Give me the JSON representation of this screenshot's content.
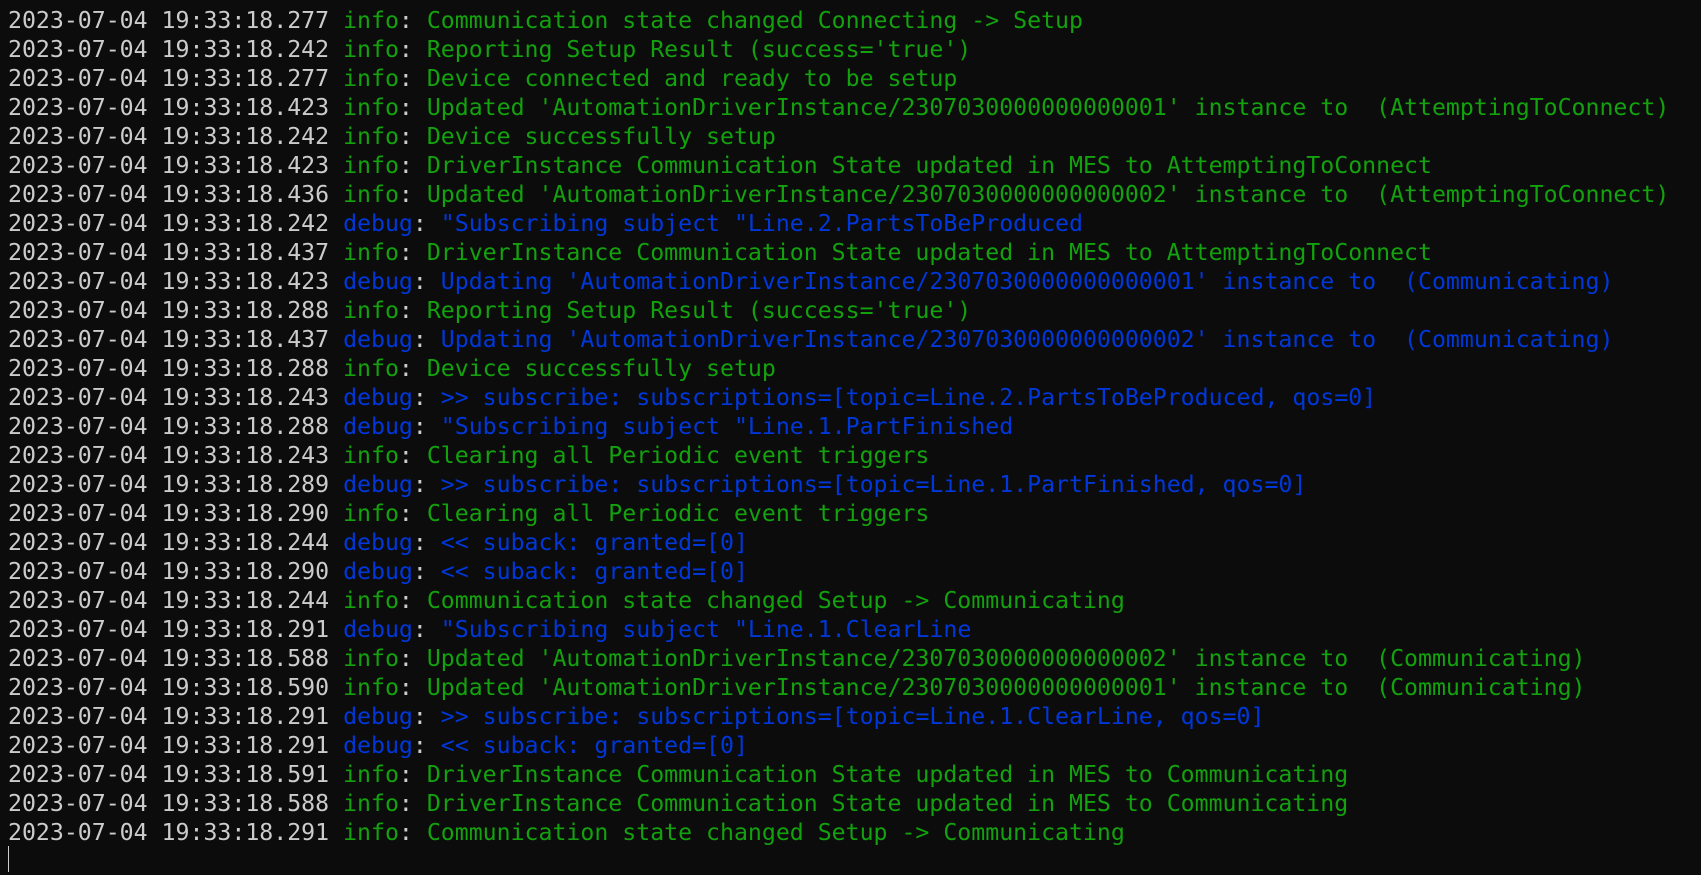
{
  "colors": {
    "background": "#0c0c0c",
    "timestamp": "#cccccc",
    "info": "#13a10e",
    "debug": "#0037da"
  },
  "log": [
    {
      "ts": "2023-07-04 19:33:18.277",
      "level": "info",
      "msg": "Communication state changed Connecting -> Setup"
    },
    {
      "ts": "2023-07-04 19:33:18.242",
      "level": "info",
      "msg": "Reporting Setup Result (success='true')"
    },
    {
      "ts": "2023-07-04 19:33:18.277",
      "level": "info",
      "msg": "Device connected and ready to be setup"
    },
    {
      "ts": "2023-07-04 19:33:18.423",
      "level": "info",
      "msg": "Updated 'AutomationDriverInstance/2307030000000000001' instance to  (AttemptingToConnect)"
    },
    {
      "ts": "2023-07-04 19:33:18.242",
      "level": "info",
      "msg": "Device successfully setup"
    },
    {
      "ts": "2023-07-04 19:33:18.423",
      "level": "info",
      "msg": "DriverInstance Communication State updated in MES to AttemptingToConnect"
    },
    {
      "ts": "2023-07-04 19:33:18.436",
      "level": "info",
      "msg": "Updated 'AutomationDriverInstance/2307030000000000002' instance to  (AttemptingToConnect)"
    },
    {
      "ts": "2023-07-04 19:33:18.242",
      "level": "debug",
      "msg": "\"Subscribing subject \"Line.2.PartsToBeProduced"
    },
    {
      "ts": "2023-07-04 19:33:18.437",
      "level": "info",
      "msg": "DriverInstance Communication State updated in MES to AttemptingToConnect"
    },
    {
      "ts": "2023-07-04 19:33:18.423",
      "level": "debug",
      "msg": "Updating 'AutomationDriverInstance/2307030000000000001' instance to  (Communicating)"
    },
    {
      "ts": "2023-07-04 19:33:18.288",
      "level": "info",
      "msg": "Reporting Setup Result (success='true')"
    },
    {
      "ts": "2023-07-04 19:33:18.437",
      "level": "debug",
      "msg": "Updating 'AutomationDriverInstance/2307030000000000002' instance to  (Communicating)"
    },
    {
      "ts": "2023-07-04 19:33:18.288",
      "level": "info",
      "msg": "Device successfully setup"
    },
    {
      "ts": "2023-07-04 19:33:18.243",
      "level": "debug",
      "msg": ">> subscribe: subscriptions=[topic=Line.2.PartsToBeProduced, qos=0]"
    },
    {
      "ts": "2023-07-04 19:33:18.288",
      "level": "debug",
      "msg": "\"Subscribing subject \"Line.1.PartFinished"
    },
    {
      "ts": "2023-07-04 19:33:18.243",
      "level": "info",
      "msg": "Clearing all Periodic event triggers"
    },
    {
      "ts": "2023-07-04 19:33:18.289",
      "level": "debug",
      "msg": ">> subscribe: subscriptions=[topic=Line.1.PartFinished, qos=0]"
    },
    {
      "ts": "2023-07-04 19:33:18.290",
      "level": "info",
      "msg": "Clearing all Periodic event triggers"
    },
    {
      "ts": "2023-07-04 19:33:18.244",
      "level": "debug",
      "msg": "<< suback: granted=[0]"
    },
    {
      "ts": "2023-07-04 19:33:18.290",
      "level": "debug",
      "msg": "<< suback: granted=[0]"
    },
    {
      "ts": "2023-07-04 19:33:18.244",
      "level": "info",
      "msg": "Communication state changed Setup -> Communicating"
    },
    {
      "ts": "2023-07-04 19:33:18.291",
      "level": "debug",
      "msg": "\"Subscribing subject \"Line.1.ClearLine"
    },
    {
      "ts": "2023-07-04 19:33:18.588",
      "level": "info",
      "msg": "Updated 'AutomationDriverInstance/2307030000000000002' instance to  (Communicating)"
    },
    {
      "ts": "2023-07-04 19:33:18.590",
      "level": "info",
      "msg": "Updated 'AutomationDriverInstance/2307030000000000001' instance to  (Communicating)"
    },
    {
      "ts": "2023-07-04 19:33:18.291",
      "level": "debug",
      "msg": ">> subscribe: subscriptions=[topic=Line.1.ClearLine, qos=0]"
    },
    {
      "ts": "2023-07-04 19:33:18.291",
      "level": "debug",
      "msg": "<< suback: granted=[0]"
    },
    {
      "ts": "2023-07-04 19:33:18.591",
      "level": "info",
      "msg": "DriverInstance Communication State updated in MES to Communicating"
    },
    {
      "ts": "2023-07-04 19:33:18.588",
      "level": "info",
      "msg": "DriverInstance Communication State updated in MES to Communicating"
    },
    {
      "ts": "2023-07-04 19:33:18.291",
      "level": "info",
      "msg": "Communication state changed Setup -> Communicating"
    }
  ]
}
